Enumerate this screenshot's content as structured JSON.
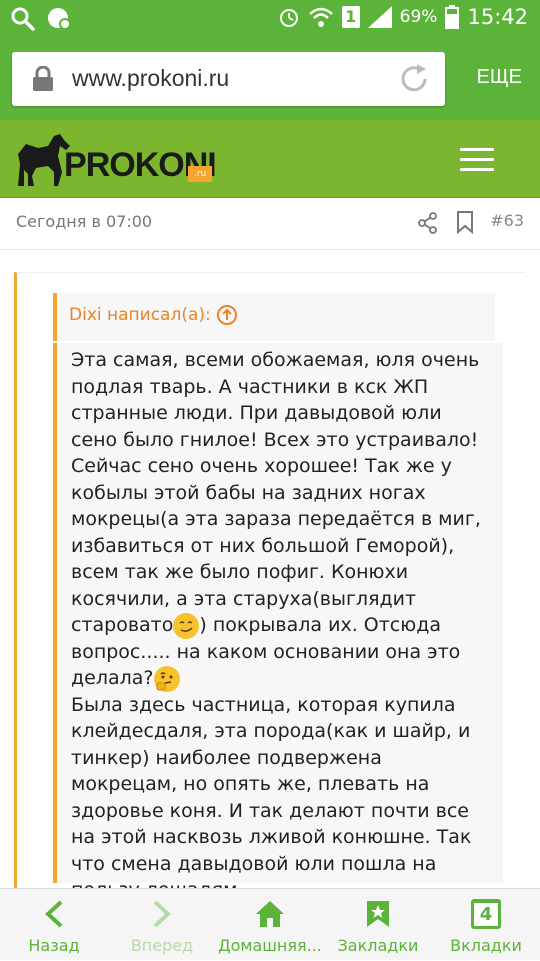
{
  "status_bar": {
    "battery_pct": "69%",
    "time": "15:42",
    "sim_badge": "1"
  },
  "browser": {
    "url": "www.prokoni.ru",
    "more_label": "ЕЩЕ"
  },
  "site": {
    "logo_text": "ROKONI",
    "logo_prefix": "P",
    "logo_domain": ".ru"
  },
  "post": {
    "date": "Сегодня в 07:00",
    "number": "#63"
  },
  "quote": {
    "author": "Dixi написал(а):",
    "text_1": "Эта самая, всеми обожаемая, юля очень подлая тварь. А частники в кск ЖП странные люди. При давыдовой юли сено было гнилое! Всех это устраивало! Сейчас сено очень хорошее! Так же у кобылы этой бабы на задних ногах мокрецы(а эта зараза передаётся в миг, избавиться от них большой Геморой), всем так же было пофиг. Конюхи косячили, а эта старуха(выглядит старовато",
    "text_2": ") покрывала их. Отсюда вопрос..... на каком основании она это делала?",
    "text_3": "Была здесь частница, которая купила клейдесдаля, эта порода(как и шайр, и тинкер) наиболее подвержена мокрецам, но опять же, плевать на здоровье коня. И так делают почти все на этой насквозь лживой конюшне. Так что смена давыдовой юли пошла на пользу лошадям."
  },
  "bottom_nav": {
    "back": "Назад",
    "forward": "Вперед",
    "home": "Домашняя...",
    "bookmarks": "Закладки",
    "tabs": "Вкладки",
    "tabs_count": "4"
  },
  "colors": {
    "accent": "#5cb33a",
    "site_green": "#7bb62e",
    "quote_border": "#f5a430",
    "quote_author": "#e8832a"
  }
}
